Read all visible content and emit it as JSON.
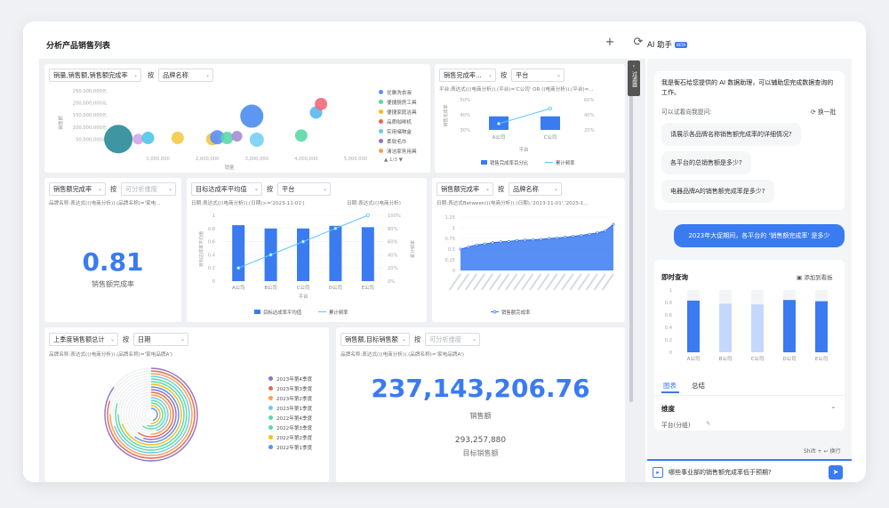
{
  "page": {
    "title": "分析产品销售列表",
    "add_icon": "plus-icon",
    "refresh_icon": "refresh-icon"
  },
  "side_tab": {
    "label": "过滤器"
  },
  "card1": {
    "measure_select": "销量,销售额,销售额完成率",
    "by": "按",
    "dim_select": "品牌名称",
    "chart_data": {
      "type": "scatter",
      "ylabel": "销售额",
      "xlabel": "销量",
      "y_ticks": [
        "250,000,000元",
        "200,000,000元",
        "150,000,000元",
        "100,000,000元",
        "50,000,000元"
      ],
      "x_ticks": [
        "1,000,000",
        "2,000,000",
        "3,000,000",
        "4,000,000",
        "5,000,000"
      ],
      "legend": [
        {
          "name": "优雅洗衣液",
          "color": "#5b8ff9"
        },
        {
          "name": "便捷厨房工具",
          "color": "#5ad8a6"
        },
        {
          "name": "便捷家庭洁具",
          "color": "#f6bd16"
        },
        {
          "name": "品质咖啡机",
          "color": "#e8684a"
        },
        {
          "name": "实用储物盒",
          "color": "#6dc8ec"
        },
        {
          "name": "柔软毛巾",
          "color": "#9270ca"
        },
        {
          "name": "清洁家务用具",
          "color": "#ff9d4d"
        }
      ],
      "legend_page": "1/3",
      "points": [
        {
          "x": 200000,
          "y": 50000000,
          "r": 16,
          "color": "#2a8a98"
        },
        {
          "x": 600000,
          "y": 50000000,
          "r": 6,
          "color": "#d3a4e8"
        },
        {
          "x": 800000,
          "y": 55000000,
          "r": 7,
          "color": "#4cc7e8"
        },
        {
          "x": 1400000,
          "y": 55000000,
          "r": 7,
          "color": "#f7c948"
        },
        {
          "x": 2100000,
          "y": 50000000,
          "r": 7,
          "color": "#f4c542"
        },
        {
          "x": 2200000,
          "y": 58000000,
          "r": 8,
          "color": "#5b8ff9"
        },
        {
          "x": 2400000,
          "y": 55000000,
          "r": 7,
          "color": "#5ad8a6"
        },
        {
          "x": 2600000,
          "y": 62000000,
          "r": 6,
          "color": "#a98cd6"
        },
        {
          "x": 2900000,
          "y": 145000000,
          "r": 13,
          "color": "#4a8cf0"
        },
        {
          "x": 3000000,
          "y": 48000000,
          "r": 8,
          "color": "#76d0f5"
        },
        {
          "x": 3900000,
          "y": 65000000,
          "r": 7,
          "color": "#5ad8a6"
        },
        {
          "x": 4200000,
          "y": 160000000,
          "r": 7,
          "color": "#5ab8f0"
        },
        {
          "x": 4300000,
          "y": 195000000,
          "r": 7,
          "color": "#f0697a"
        }
      ]
    }
  },
  "card2": {
    "measure_select": "销售完成率...",
    "by": "按",
    "dim_select": "平台",
    "filter": "平台:表达式(((电商分析)).(平台)='C公司' OR ((电商分析)).(平台)=...",
    "chart_data": {
      "type": "bar",
      "categories": [
        "A公司",
        "C公司"
      ],
      "series": [
        {
          "name": "销售完成率百分比",
          "values": [
            40,
            40
          ]
        },
        {
          "name": "累计频率",
          "values": [
            50,
            100
          ]
        }
      ],
      "y_left_ticks": [
        "50%",
        "40%",
        "30%"
      ],
      "y_right_ticks": [
        "60%",
        "40%",
        "20%"
      ],
      "xlabel": "平台",
      "ylabel": "销售完成率"
    }
  },
  "card3": {
    "measure_select": "销售额完成率",
    "by": "按",
    "dim_placeholder": "可分析维度",
    "filter": "品牌名称:表达式(((电商分析)).(品牌名称)='家电...",
    "value": "0.81",
    "label": "销售额完成率"
  },
  "card4": {
    "measure_select": "目标达成率平均值",
    "by": "按",
    "dim_select": "平台",
    "filter1": "日期:表达式(((电商分析)).(日期)>='2023-11-01')",
    "filter2": "日期:表达式(((电商分析)",
    "chart_data": {
      "type": "bar",
      "categories": [
        "A公司",
        "B公司",
        "C公司",
        "D公司",
        "E公司"
      ],
      "series": [
        {
          "name": "目标达成率平均值",
          "values": [
            0.85,
            0.8,
            0.8,
            0.84,
            0.82
          ]
        },
        {
          "name": "累计频率",
          "values": [
            20,
            40,
            60,
            80,
            100
          ]
        }
      ],
      "y_left_ticks": [
        "1",
        "0.8",
        "0.6",
        "0.4",
        "0.2",
        "0"
      ],
      "y_right_ticks": [
        "100%",
        "80%",
        "60%",
        "40%",
        "20%",
        "0%"
      ],
      "xlabel": "平台",
      "ylabel": "目标达成率平均值",
      "y2label": "累计频率"
    }
  },
  "card5": {
    "measure_select": "销售额完成率",
    "by": "按",
    "dim_select": "品牌名称",
    "filter": "日期:表达式Between(((电商分析)).(日期),'2023-11-01','2023-1...",
    "chart_data": {
      "type": "area",
      "y_ticks": [
        "1.25",
        "1",
        "0.75",
        "0.5",
        "0.25",
        "0"
      ],
      "series_name": "销售额完成率",
      "values": [
        0.5,
        0.55,
        0.6,
        0.62,
        0.65,
        0.67,
        0.68,
        0.7,
        0.71,
        0.72,
        0.73,
        0.75,
        0.76,
        0.78,
        0.8,
        0.82,
        0.85,
        0.88,
        0.93,
        1.08
      ]
    }
  },
  "card6": {
    "measure_select": "上季度销售额总计",
    "by": "按",
    "dim_select": "日期",
    "filter": "品牌名称:表达式(((电商分析)).(品牌名称)='家电品牌A')",
    "chart_data": {
      "type": "radial-bar",
      "legend": [
        {
          "name": "2023年第4季度",
          "color": "#9270ca"
        },
        {
          "name": "2023年第3季度",
          "color": "#e8684a"
        },
        {
          "name": "2023年第2季度",
          "color": "#ff9d4d"
        },
        {
          "name": "2023年第1季度",
          "color": "#6dc8ec"
        },
        {
          "name": "2022年第4季度",
          "color": "#5ad8a6"
        },
        {
          "name": "2022年第3季度",
          "color": "#5ad8a6"
        },
        {
          "name": "2022年第2季度",
          "color": "#f6bd16"
        },
        {
          "name": "2022年第1季度",
          "color": "#5b8ff9"
        }
      ],
      "values": [
        0.85,
        0.8,
        0.75,
        0.7,
        0.8,
        0.75,
        0.7,
        0.6,
        0.55,
        0.6,
        0.5,
        0.45,
        0.6,
        0.55,
        0.5,
        0.45
      ]
    }
  },
  "card7": {
    "measure_select": "销售额,目标销售额",
    "by": "按",
    "dim_placeholder": "可分析维度",
    "filter": "品牌名称:表达式(((电商分析)).(品牌名称)='家电品牌A')",
    "value": "237,143,206.76",
    "label": "销售额",
    "sub_value": "293,257,880",
    "sub_label": "目标销售额"
  },
  "assistant": {
    "title": "AI 助手",
    "beta": "BETA",
    "intro": "我是衡石给您提供的 AI 数据助理，可以辅助您完成数据查询的工作。",
    "try_label": "可以试着向我提问:",
    "refresh_label": "换一批",
    "suggestions": [
      "请展示各品牌名称销售额完成率的详细情况?",
      "各平台的总销售额是多少?",
      "电器品牌A的销售额完成率是多少?"
    ],
    "user_message": "2023年大促期间，各平台的 '销售额完成率' 是多少",
    "result_title": "即时查询",
    "add_to_board": "添加到看板",
    "result_chart": {
      "type": "bar",
      "categories": [
        "A公司",
        "B公司",
        "C公司",
        "D公司",
        "E公司"
      ],
      "values": [
        0.83,
        0.78,
        0.77,
        0.84,
        0.82
      ],
      "colors": [
        "#3a7bf2",
        "#c5d7fb",
        "#c5d7fb",
        "#3a7bf2",
        "#3a7bf2"
      ],
      "y_ticks": [
        "1",
        "0.8",
        "0.6",
        "0.4",
        "0.2",
        "0"
      ]
    },
    "tabs": [
      "图表",
      "总结"
    ],
    "dimension_label": "维度",
    "dimension_value": "平台(分组)",
    "input_value": "哪些事业部的销售额完成率低于预期?",
    "shift_hint": "Shift +",
    "newline_hint": "换行"
  }
}
